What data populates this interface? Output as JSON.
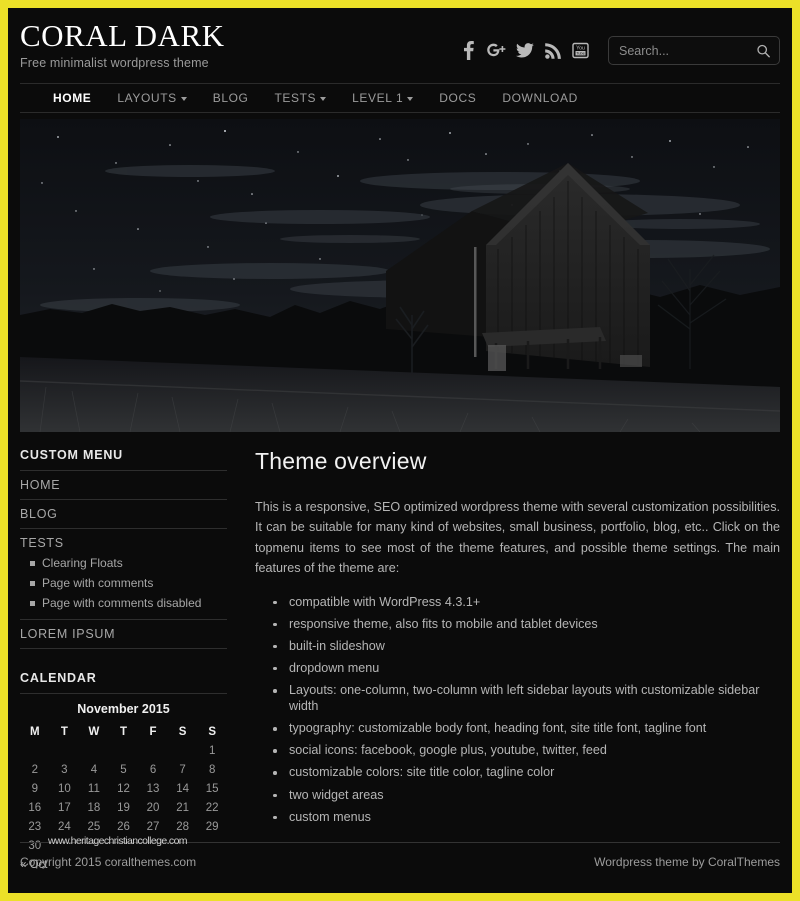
{
  "theme": {
    "frame_color": "#ece028",
    "background": "#0b0b0b",
    "accent_text": "#ffffff",
    "muted_text": "#9a9a9a"
  },
  "header": {
    "site_title": "CORAL DARK",
    "tagline": "Free minimalist wordpress theme",
    "social": [
      {
        "name": "facebook-icon",
        "label": "Facebook"
      },
      {
        "name": "google-plus-icon",
        "label": "Google Plus"
      },
      {
        "name": "twitter-icon",
        "label": "Twitter"
      },
      {
        "name": "rss-feed-icon",
        "label": "Feed"
      },
      {
        "name": "youtube-icon",
        "label": "YouTube"
      }
    ],
    "search": {
      "placeholder": "Search...",
      "value": "",
      "icon": "search-icon"
    }
  },
  "nav": {
    "items": [
      {
        "label": "HOME",
        "active": true,
        "dropdown": false
      },
      {
        "label": "LAYOUTS",
        "active": false,
        "dropdown": true
      },
      {
        "label": "BLOG",
        "active": false,
        "dropdown": false
      },
      {
        "label": "TESTS",
        "active": false,
        "dropdown": true
      },
      {
        "label": "LEVEL 1",
        "active": false,
        "dropdown": true
      },
      {
        "label": "DOCS",
        "active": false,
        "dropdown": false
      },
      {
        "label": "DOWNLOAD",
        "active": false,
        "dropdown": false
      }
    ]
  },
  "hero": {
    "alt": "Night photograph of a wooden barn under a starry sky with a grassy field"
  },
  "sidebar": {
    "custom_menu": {
      "title": "CUSTOM MENU",
      "items": [
        {
          "label": "HOME"
        },
        {
          "label": "BLOG"
        },
        {
          "label": "TESTS"
        }
      ],
      "tests_children": [
        {
          "label": "Clearing Floats"
        },
        {
          "label": "Page with comments"
        },
        {
          "label": "Page with comments disabled"
        }
      ],
      "last_item": {
        "label": "LOREM IPSUM"
      }
    },
    "calendar": {
      "title": "CALENDAR",
      "caption": "November 2015",
      "weekdays": [
        "M",
        "T",
        "W",
        "T",
        "F",
        "S",
        "S"
      ],
      "weeks": [
        [
          "",
          "",
          "",
          "",
          "",
          "",
          "1"
        ],
        [
          "2",
          "3",
          "4",
          "5",
          "6",
          "7",
          "8"
        ],
        [
          "9",
          "10",
          "11",
          "12",
          "13",
          "14",
          "15"
        ],
        [
          "16",
          "17",
          "18",
          "19",
          "20",
          "21",
          "22"
        ],
        [
          "23",
          "24",
          "25",
          "26",
          "27",
          "28",
          "29"
        ],
        [
          "30",
          "",
          "",
          "",
          "",
          "",
          ""
        ]
      ],
      "prev_label": "« Oct"
    }
  },
  "main": {
    "title": "Theme overview",
    "paragraph": "This is a responsive, SEO optimized wordpress theme with several customization possibilities. It can be suitable for many kind of websites, small business, portfolio, blog, etc.. Click on the topmenu items to see most of the theme features, and possible theme settings. The main features of the theme are:",
    "features": [
      "compatible with WordPress 4.3.1+",
      "responsive theme, also fits to mobile and tablet devices",
      "built-in slideshow",
      "dropdown menu",
      "Layouts: one-column, two-column with left sidebar layouts with customizable sidebar width",
      "typography: customizable body font, heading font, site title font, tagline font",
      "social icons: facebook, google plus, youtube, twitter, feed",
      "customizable colors: site title color, tagline color",
      "two widget areas",
      "custom menus"
    ]
  },
  "footer": {
    "copyright": "Copyright 2015 coralthemes.com",
    "credit": "Wordpress theme by CoralThemes",
    "watermark": "www.heritagechristiancollege.com"
  }
}
